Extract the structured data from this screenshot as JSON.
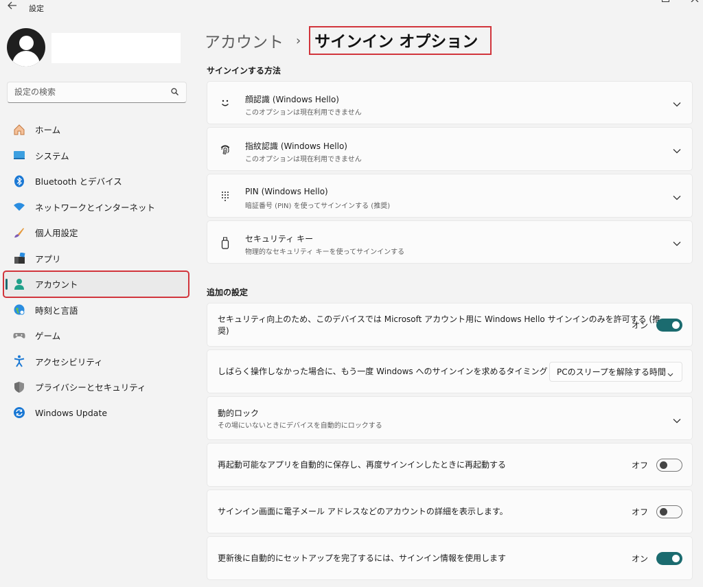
{
  "window": {
    "title": "設定"
  },
  "search": {
    "placeholder": "設定の検索"
  },
  "sidebar": {
    "items": [
      {
        "label": "ホーム",
        "icon": "home-icon"
      },
      {
        "label": "システム",
        "icon": "system-icon"
      },
      {
        "label": "Bluetooth とデバイス",
        "icon": "bluetooth-icon"
      },
      {
        "label": "ネットワークとインターネット",
        "icon": "wifi-icon"
      },
      {
        "label": "個人用設定",
        "icon": "brush-icon"
      },
      {
        "label": "アプリ",
        "icon": "apps-icon"
      },
      {
        "label": "アカウント",
        "icon": "account-icon",
        "active": true
      },
      {
        "label": "時刻と言語",
        "icon": "globe-icon"
      },
      {
        "label": "ゲーム",
        "icon": "gamepad-icon"
      },
      {
        "label": "アクセシビリティ",
        "icon": "accessibility-icon"
      },
      {
        "label": "プライバシーとセキュリティ",
        "icon": "shield-icon"
      },
      {
        "label": "Windows Update",
        "icon": "update-icon"
      }
    ]
  },
  "header": {
    "parent": "アカウント",
    "separator": "›",
    "current": "サインイン オプション"
  },
  "signin_methods": {
    "title": "サインインする方法",
    "items": [
      {
        "title": "顔認識 (Windows Hello)",
        "subtitle": "このオプションは現在利用できません",
        "icon": "face-icon"
      },
      {
        "title": "指紋認識 (Windows Hello)",
        "subtitle": "このオプションは現在利用できません",
        "icon": "fingerprint-icon"
      },
      {
        "title": "PIN (Windows Hello)",
        "subtitle": "暗証番号 (PIN) を使ってサインインする (推奨)",
        "icon": "pin-keypad-icon"
      },
      {
        "title": "セキュリティ キー",
        "subtitle": "物理的なセキュリティ キーを使ってサインインする",
        "icon": "usb-key-icon"
      }
    ]
  },
  "additional": {
    "title": "追加の設定",
    "hello_only": {
      "text_line1": "セキュリティ向上のため、このデバイスでは Microsoft アカウント用に Windows Hello サインインのみを許可する (推",
      "text_line2": "奨)",
      "state_label": "オン",
      "on": true
    },
    "require_signin": {
      "text": "しばらく操作しなかった場合に、もう一度 Windows へのサインインを求めるタイミング",
      "selected": "PCのスリープを解除する時間"
    },
    "dynamic_lock": {
      "title": "動的ロック",
      "subtitle": "その場にいないときにデバイスを自動的にロックする"
    },
    "restart_apps": {
      "text": "再起動可能なアプリを自動的に保存し、再度サインインしたときに再起動する",
      "state_label": "オフ",
      "on": false
    },
    "show_details": {
      "text": "サインイン画面に電子メール アドレスなどのアカウントの詳細を表示します。",
      "state_label": "オフ",
      "on": false
    },
    "auto_finish": {
      "text": "更新後に自動的にセットアップを完了するには、サインイン情報を使用します",
      "state_label": "オン",
      "on": true
    }
  },
  "colors": {
    "accent": "#1b6b6f",
    "highlight_border": "#d1343b"
  }
}
